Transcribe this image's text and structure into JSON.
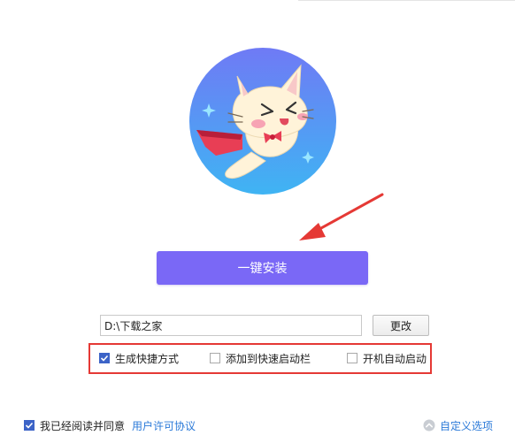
{
  "install": {
    "label": "一键安装"
  },
  "path": {
    "value": "D:\\下载之家"
  },
  "change_button": {
    "label": "更改"
  },
  "options": [
    {
      "label": "生成快捷方式",
      "checked": true
    },
    {
      "label": "添加到快速启动栏",
      "checked": false
    },
    {
      "label": "开机自动启动",
      "checked": false
    }
  ],
  "agreement": {
    "label": "我已经阅读并同意",
    "link": "用户许可协议",
    "checked": true
  },
  "custom": {
    "label": "自定义选项"
  },
  "colors": {
    "accent": "#7a68f6",
    "link": "#2a79d8",
    "highlight": "#e53935",
    "logo_blue": "#3ba2f2"
  },
  "icons": [
    "cat-mascot-logo",
    "red-arrow-icon",
    "checkmark-icon",
    "chevron-up-circle-icon"
  ]
}
